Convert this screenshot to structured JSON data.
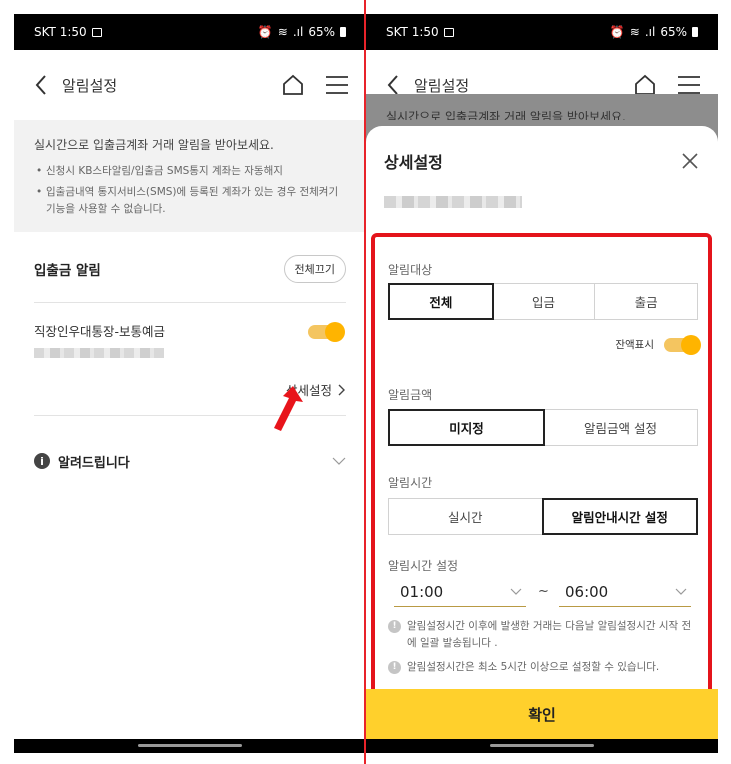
{
  "status": {
    "carrier_time": "SKT 1:50",
    "battery": "65%"
  },
  "left": {
    "appbar_title": "알림설정",
    "notice": {
      "main": "실시간으로 입출금계좌 거래 알림을 받아보세요.",
      "bullets": [
        "신청시 KB스타알림/입출금 SMS통지 계좌는 자동해지",
        "입출금내역 통지서비스(SMS)에 등록된 계좌가 있는 경우 전체켜기 기능을 사용할 수 없습니다."
      ]
    },
    "section_label": "입출금 알림",
    "all_off_button": "전체끄기",
    "account_name": "직장인우대통장-보통예금",
    "account_toggle_on": true,
    "detail_link": "상세설정",
    "info_label": "알려드립니다"
  },
  "right": {
    "appbar_title": "알림설정",
    "dim_notice": "실시간으로 입출금계좌 거래 알림을 받아보세요.",
    "sheet_title": "상세설정",
    "target_label": "알림대상",
    "target_options": [
      "전체",
      "입금",
      "출금"
    ],
    "target_selected": "전체",
    "balance_label": "잔액표시",
    "balance_toggle_on": true,
    "amount_label": "알림금액",
    "amount_options": [
      "미지정",
      "알림금액 설정"
    ],
    "amount_selected": "미지정",
    "time_label": "알림시간",
    "time_options": [
      "실시간",
      "알림안내시간 설정"
    ],
    "time_selected": "알림안내시간 설정",
    "time_setting_label": "알림시간 설정",
    "start_time": "01:00",
    "end_time": "06:00",
    "tilde": "~",
    "hints": [
      "알림설정시간 이후에 발생한 거래는 다음날 알림설정시간 시작 전에 일괄 발송됩니다 .",
      "알림설정시간은 최소 5시간 이상으로 설정할 수 있습니다."
    ],
    "confirm_button": "확인"
  },
  "colors": {
    "accent_yellow": "#ffd02c",
    "toggle_knob": "#ffb400",
    "highlight_red": "#e4141b"
  }
}
